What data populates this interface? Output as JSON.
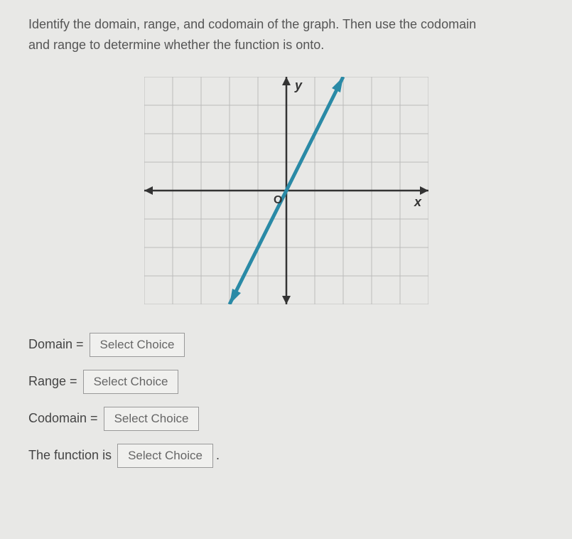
{
  "question": {
    "line1": "Identify the domain, range, and codomain of the graph. Then use the codomain",
    "line2": "and range to determine whether the function is onto."
  },
  "graph": {
    "y_label": "y",
    "x_label": "x",
    "origin_label": "O"
  },
  "answers": {
    "domain_label": "Domain =",
    "range_label": "Range =",
    "codomain_label": "Codomain =",
    "function_label": "The function is",
    "select_placeholder": "Select Choice"
  },
  "chart_data": {
    "type": "line",
    "title": "",
    "x_axis_range": [
      -5,
      5
    ],
    "y_axis_range": [
      -4,
      4
    ],
    "grid": true,
    "series": [
      {
        "name": "line",
        "points": [
          {
            "x": -2,
            "y": -4
          },
          {
            "x": 2,
            "y": 4
          }
        ],
        "extends_infinitely": true,
        "arrows_both_ends": true,
        "color": "#2a8aa6"
      }
    ],
    "axes": {
      "x_arrows": true,
      "y_arrows": true
    }
  }
}
